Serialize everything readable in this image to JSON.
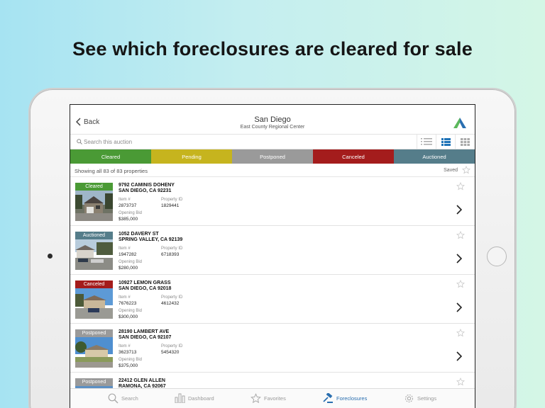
{
  "headline": "See which foreclosures are cleared for sale",
  "nav": {
    "back_label": "Back",
    "title": "San Diego",
    "subtitle": "East County Regional Center"
  },
  "search": {
    "placeholder": "Search this auction"
  },
  "view_toggle": [
    "list-icon",
    "card-list-icon",
    "grid-icon"
  ],
  "statuses": [
    {
      "label": "Cleared",
      "color": "#4a9a35"
    },
    {
      "label": "Pending",
      "color": "#c6b41e"
    },
    {
      "label": "Postponed",
      "color": "#9a9a9a"
    },
    {
      "label": "Canceled",
      "color": "#a41c1c"
    },
    {
      "label": "Auctioned",
      "color": "#557d8a"
    }
  ],
  "summary": {
    "text": "Showing all 83 of 83 properties",
    "saved_label": "Saved"
  },
  "field_labels": {
    "item": "Item #",
    "property_id": "Property ID",
    "opening_bid": "Opening Bid"
  },
  "listings": [
    {
      "status": "Cleared",
      "status_color": "#4a9a35",
      "address1": "9792 CAMINIS DOHENY",
      "address2": "SAN DIEGO, CA 92231",
      "item": "2873737",
      "property_id": "1829441",
      "opening_bid": "$385,000"
    },
    {
      "status": "Auctioned",
      "status_color": "#557d8a",
      "address1": "1052 DAVERY ST",
      "address2": "SPRING VALLEY, CA 92139",
      "item": "1947282",
      "property_id": "6718393",
      "opening_bid": "$280,000"
    },
    {
      "status": "Canceled",
      "status_color": "#a41c1c",
      "address1": "10927 LEMON GRASS",
      "address2": "SAN DIEGO, CA 92018",
      "item": "7676223",
      "property_id": "4612432",
      "opening_bid": "$300,000"
    },
    {
      "status": "Postponed",
      "status_color": "#9a9a9a",
      "address1": "28190 LAMBERT AVE",
      "address2": "SAN DIEGO, CA 92107",
      "item": "3623713",
      "property_id": "5454320",
      "opening_bid": "$375,000"
    },
    {
      "status": "Postponed",
      "status_color": "#9a9a9a",
      "address1": "22412 GLEN ALLEN",
      "address2": "RAMONA, CA 92067",
      "item": "",
      "property_id": "",
      "opening_bid": ""
    }
  ],
  "tabs": [
    {
      "label": "Search",
      "icon": "search-icon",
      "active": false
    },
    {
      "label": "Dashboard",
      "icon": "bar-chart-icon",
      "active": false
    },
    {
      "label": "Favorites",
      "icon": "star-icon",
      "active": false
    },
    {
      "label": "Foreclosures",
      "icon": "gavel-icon",
      "active": true
    },
    {
      "label": "Settings",
      "icon": "gear-icon",
      "active": false
    }
  ],
  "colors": {
    "accent": "#2a6fb0",
    "logo_green": "#5cb85c",
    "logo_blue": "#2a6fb0"
  }
}
